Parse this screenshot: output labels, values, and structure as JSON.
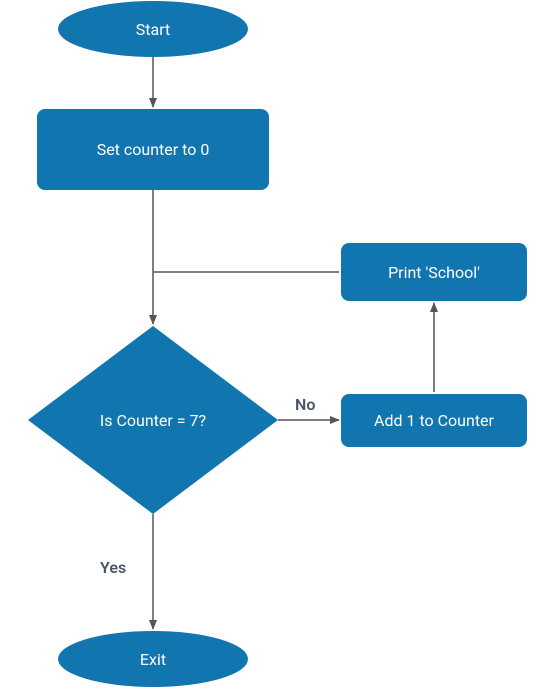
{
  "nodes": {
    "start": {
      "label": "Start"
    },
    "set_counter": {
      "label": "Set counter to 0"
    },
    "decision": {
      "label": "Is Counter = 7?"
    },
    "add_counter": {
      "label": "Add 1 to Counter"
    },
    "print_school": {
      "label": "Print 'School'"
    },
    "exit": {
      "label": "Exit"
    }
  },
  "edges": {
    "no": {
      "label": "No"
    },
    "yes": {
      "label": "Yes"
    }
  },
  "style": {
    "fill": "#1176b0",
    "stroke": "#555555",
    "label_color": "#4a5568"
  }
}
